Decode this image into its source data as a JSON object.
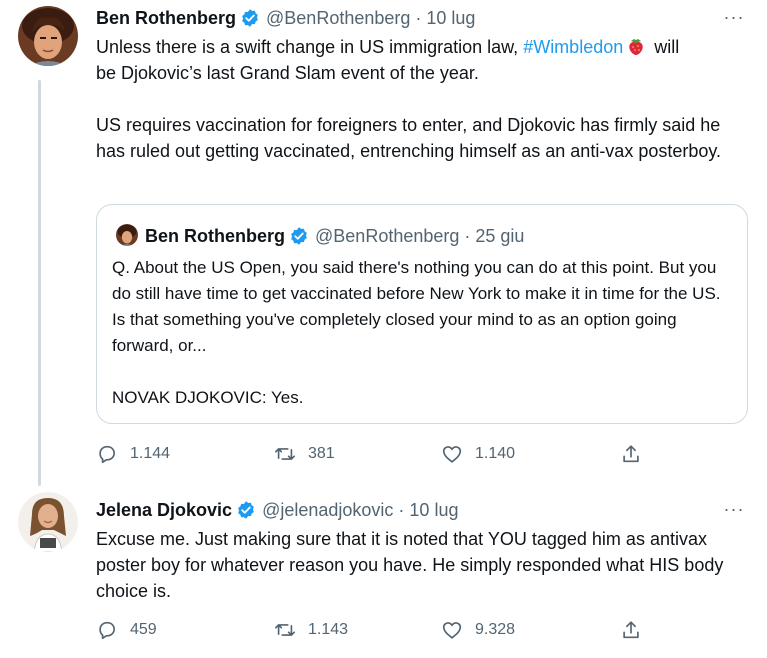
{
  "tweets": [
    {
      "author": "Ben Rothenberg",
      "handle": "@BenRothenberg",
      "separator": "·",
      "time": "10 lug",
      "more": "···",
      "text_line1_pre": "Unless there is a swift change in US immigration law, ",
      "hashtag": "#Wimbledon",
      "text_line1_post": " will",
      "text_line2": "be Djokovic’s last Grand Slam event of the year.",
      "paragraph2": "US requires vaccination for foreigners to enter, and Djokovic has firmly said he has ruled out getting vaccinated, entrenching himself as an anti-vax posterboy.",
      "quoted": {
        "author": "Ben Rothenberg",
        "handle": "@BenRothenberg",
        "separator": "·",
        "time": "25 giu",
        "paragraph1": "Q. About the US Open, you said there's nothing you can do at this point. But you do still have time to get vaccinated before New York to make it in time for the US. Is that something you've completely closed your mind to as an option going forward, or...",
        "paragraph2": "NOVAK DJOKOVIC: Yes."
      },
      "stats": {
        "replies": "1.144",
        "retweets": "381",
        "likes": "1.140"
      }
    },
    {
      "author": "Jelena Djokovic",
      "handle": "@jelenadjokovic",
      "separator": "·",
      "time": "10 lug",
      "more": "···",
      "text": "Excuse me. Just making sure that it is noted that YOU tagged him as antivax poster boy for whatever reason you have. He simply responded what HIS body choice is.",
      "stats": {
        "replies": "459",
        "retweets": "1.143",
        "likes": "9.328"
      }
    }
  ],
  "icons": {
    "verified": "verified-badge-icon",
    "emoji": "strawberry-emoji-icon",
    "reply": "reply-icon",
    "retweet": "retweet-icon",
    "like": "like-icon",
    "share": "share-icon",
    "more": "more-icon"
  },
  "colors": {
    "text": "#0f1419",
    "secondary": "#536471",
    "link": "#1d9bf0",
    "verified": "#1d9bf0",
    "border": "#cfd9de",
    "background": "#ffffff"
  }
}
